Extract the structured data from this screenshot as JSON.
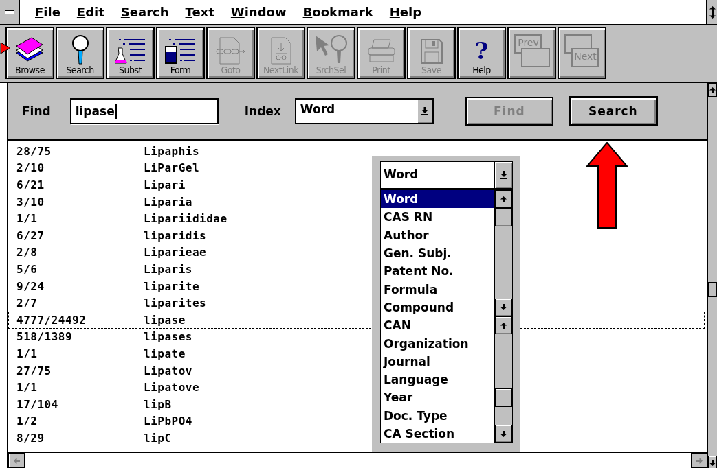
{
  "menu": [
    {
      "label": "File"
    },
    {
      "label": "Edit"
    },
    {
      "label": "Search"
    },
    {
      "label": "Text"
    },
    {
      "label": "Window"
    },
    {
      "label": "Bookmark"
    },
    {
      "label": "Help"
    }
  ],
  "toolbar": [
    {
      "kind": "books",
      "label": "Browse",
      "disabled": false
    },
    {
      "kind": "magnifier",
      "label": "Search",
      "disabled": false
    },
    {
      "kind": "flask",
      "label": "Subst",
      "disabled": false
    },
    {
      "kind": "beaker",
      "label": "Form",
      "disabled": false
    },
    {
      "kind": "chain",
      "label": "Goto",
      "disabled": true
    },
    {
      "kind": "link",
      "label": "NextLink",
      "disabled": true
    },
    {
      "kind": "pointer",
      "label": "SrchSel",
      "disabled": true
    },
    {
      "kind": "printer",
      "label": "Print",
      "disabled": true
    },
    {
      "kind": "floppy",
      "label": "Save",
      "disabled": true
    },
    {
      "kind": "glyph",
      "glyph": "?",
      "label": "Help",
      "disabled": false
    },
    {
      "kind": "prev",
      "text": "Prev",
      "disabled": true
    },
    {
      "kind": "next",
      "text": "Next",
      "disabled": true
    }
  ],
  "find": {
    "label": "Find",
    "value": "lipase",
    "index_label": "Index",
    "index_value": "Word",
    "find_button": {
      "label": "Find",
      "disabled": true
    },
    "search_button": {
      "label": "Search",
      "disabled": false
    }
  },
  "results": [
    {
      "count": "28/75",
      "term": "Lipaphis",
      "focused": false
    },
    {
      "count": "2/10",
      "term": "LiParGel",
      "focused": false
    },
    {
      "count": "6/21",
      "term": "Lipari",
      "focused": false
    },
    {
      "count": "3/10",
      "term": "Liparia",
      "focused": false
    },
    {
      "count": "1/1",
      "term": "Lipariididae",
      "focused": false
    },
    {
      "count": "6/27",
      "term": "liparidis",
      "focused": false
    },
    {
      "count": "2/8",
      "term": "Liparieae",
      "focused": false
    },
    {
      "count": "5/6",
      "term": "Liparis",
      "focused": false
    },
    {
      "count": "9/24",
      "term": "liparite",
      "focused": false
    },
    {
      "count": "2/7",
      "term": "liparites",
      "focused": false
    },
    {
      "count": "4777/24492",
      "term": "lipase",
      "focused": true
    },
    {
      "count": "518/1389",
      "term": "lipases",
      "focused": false
    },
    {
      "count": "1/1",
      "term": "lipate",
      "focused": false
    },
    {
      "count": "27/75",
      "term": "Lipatov",
      "focused": false
    },
    {
      "count": "1/1",
      "term": "Lipatove",
      "focused": false
    },
    {
      "count": "17/104",
      "term": "lipB",
      "focused": false
    },
    {
      "count": "1/2",
      "term": "LiPbPO4",
      "focused": false
    },
    {
      "count": "8/29",
      "term": "lipC",
      "focused": false
    }
  ],
  "dropdown": {
    "value": "Word",
    "options": [
      {
        "label": "Word",
        "selected": true
      },
      {
        "label": "CAS RN",
        "selected": false
      },
      {
        "label": "Author",
        "selected": false
      },
      {
        "label": "Gen. Subj.",
        "selected": false
      },
      {
        "label": "Patent No.",
        "selected": false
      },
      {
        "label": "Formula",
        "selected": false
      },
      {
        "label": "Compound",
        "selected": false
      },
      {
        "label": "CAN",
        "selected": false
      },
      {
        "label": "Organization",
        "selected": false
      },
      {
        "label": "Journal",
        "selected": false
      },
      {
        "label": "Language",
        "selected": false
      },
      {
        "label": "Year",
        "selected": false
      },
      {
        "label": "Doc. Type",
        "selected": false
      },
      {
        "label": "CA Section",
        "selected": false
      }
    ]
  }
}
